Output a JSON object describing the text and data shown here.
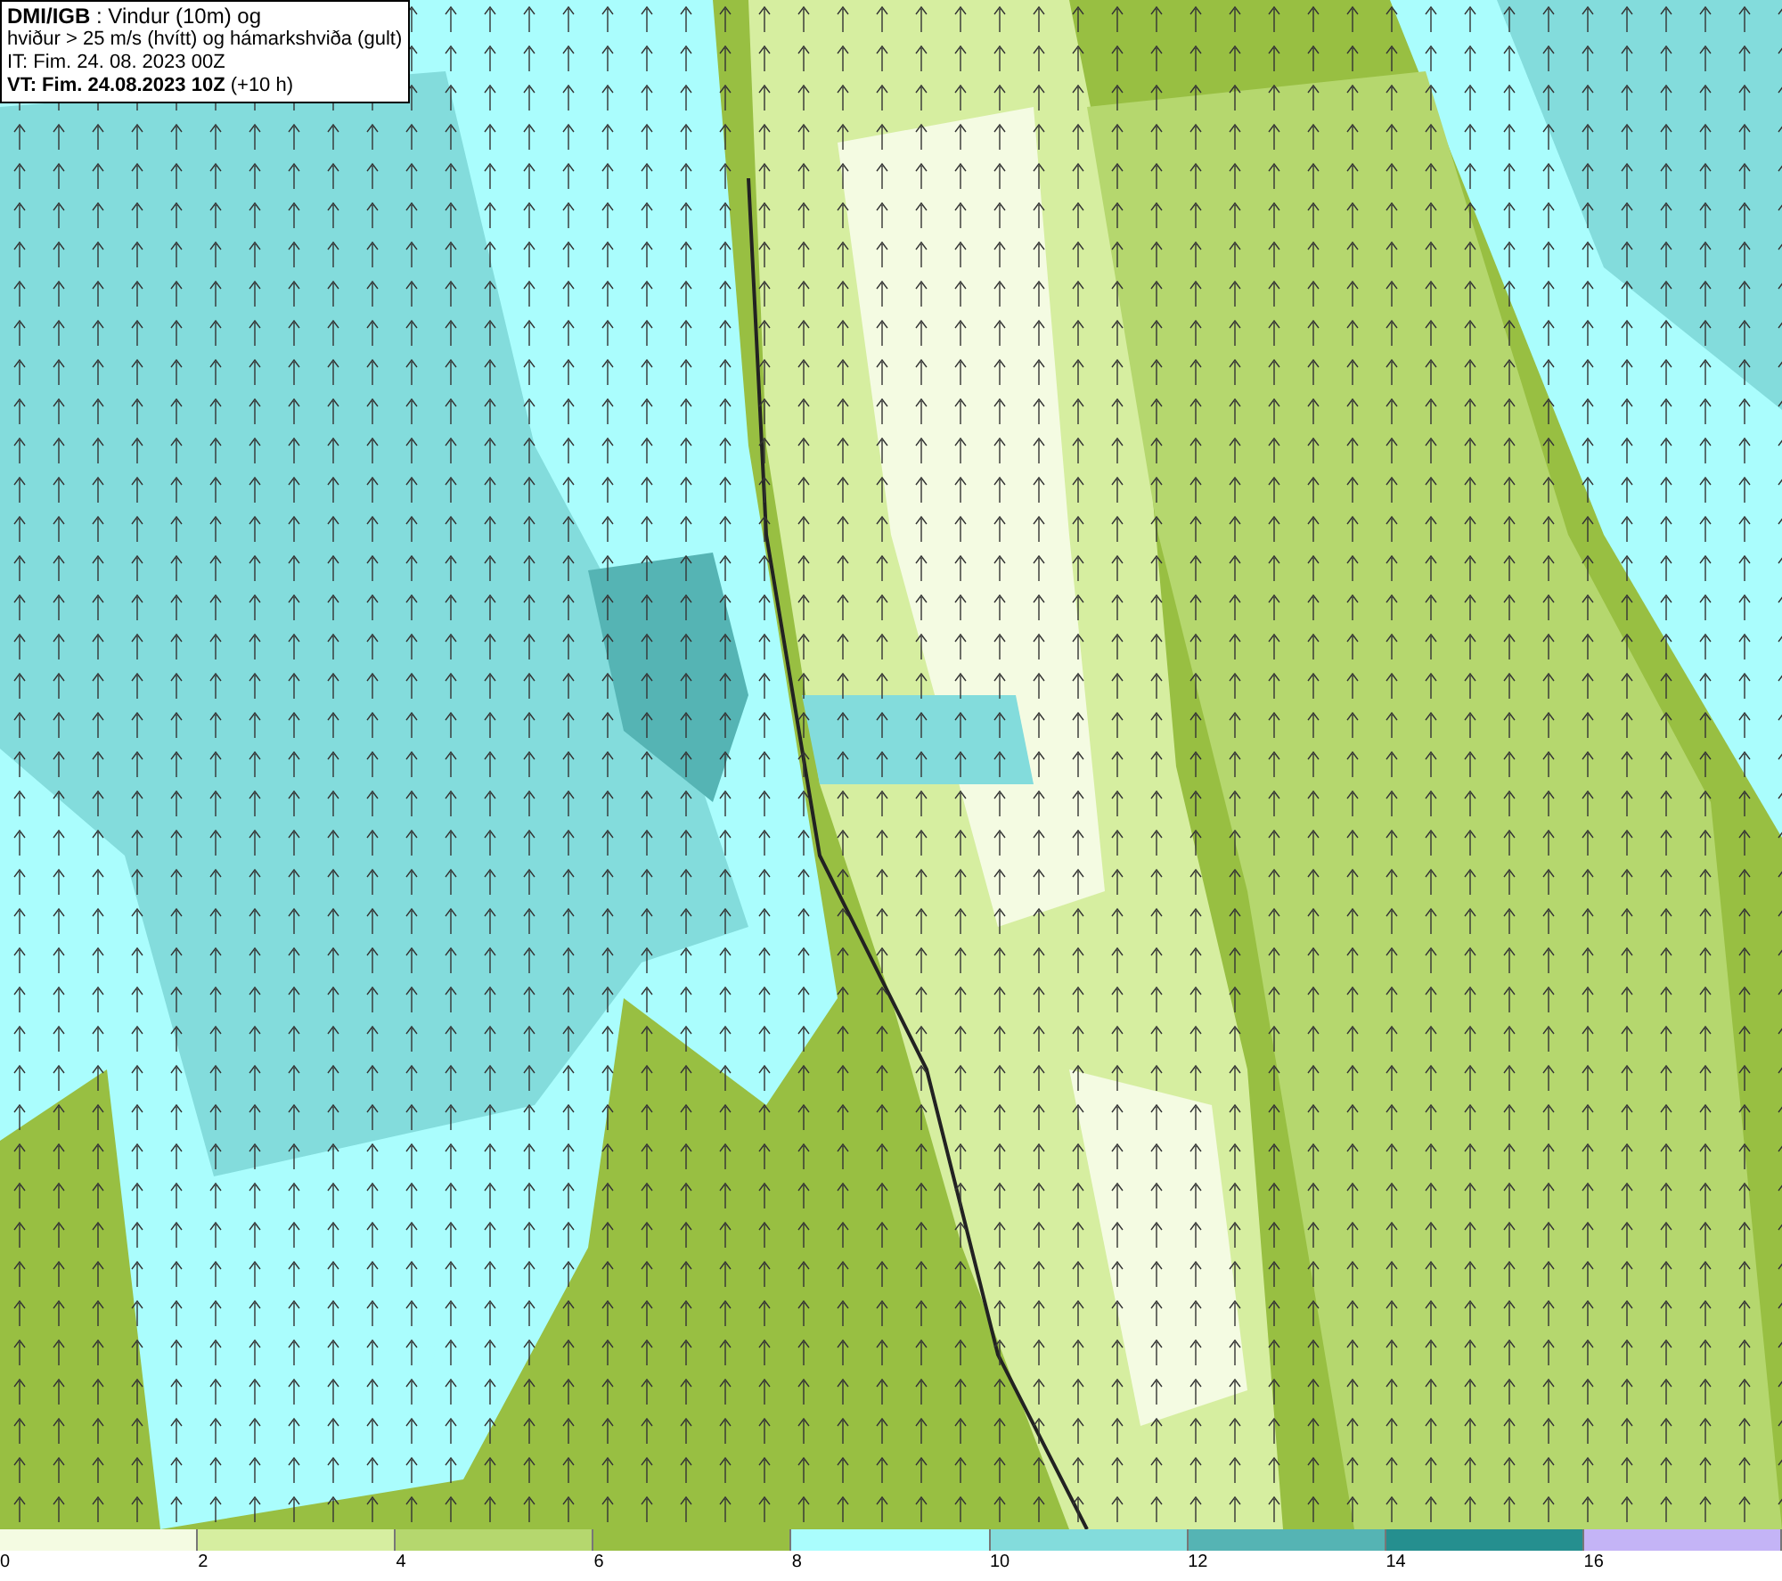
{
  "info_box": {
    "lines": [
      "**DMI/IGB** : Vindur (10m) og",
      "hviður > 25 m/s (hvítt) og hámarkshviða (gult)",
      "IT: Fim. 24. 08. 2023 00Z",
      "**VT: Fim. 24.08.2023 10Z** (+10 h)"
    ]
  },
  "legend": {
    "bins": [
      {
        "color": "#f4fbe2"
      },
      {
        "color": "#d6eea0"
      },
      {
        "color": "#b5d76e"
      },
      {
        "color": "#98bf42"
      },
      {
        "color": "#aafdfd"
      },
      {
        "color": "#83dcdc"
      },
      {
        "color": "#55b4b4"
      },
      {
        "color": "#258f8f"
      },
      {
        "color": "#c4b4f6"
      }
    ],
    "ticks": [
      "0",
      "2",
      "4",
      "6",
      "8",
      "10",
      "12",
      "14",
      "16"
    ]
  }
}
